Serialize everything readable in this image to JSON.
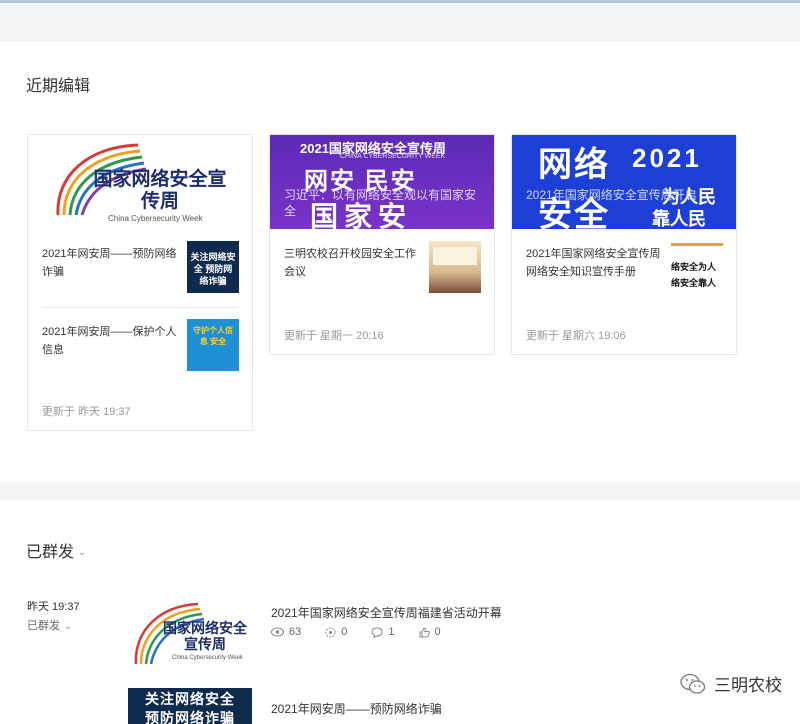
{
  "recent": {
    "title": "近期编辑",
    "cards": [
      {
        "cover_logo_cn": "国家网络安全宣传周",
        "cover_logo_en": "China Cybersecurity Week",
        "items": [
          {
            "title": "2021年网安周——预防网络诈骗",
            "thumb_text": "关注网络安全 预防网络诈骗"
          },
          {
            "title": "2021年网安周——保护个人信息",
            "thumb_text": "守护个人信息 安全"
          }
        ],
        "updated": "更新于 昨天 19:37"
      },
      {
        "cover_title": "习近平：以有网络安全观以有国家安全",
        "cover_banner": "2021国家网络安全宣传周",
        "cover_banner_en": "CHINA CYBERSECURITY WEEK",
        "cover_slogan_1": "网安 民安",
        "cover_slogan_2": "国家安",
        "items": [
          {
            "title": "三明农校召开校园安全工作会议"
          }
        ],
        "updated": "更新于 星期一 20:16"
      },
      {
        "cover_title": "2021年国家网络安全宣传周开启",
        "cover_big_1": "网络",
        "cover_big_2": "安全",
        "cover_year": "2021",
        "cover_slogan_1": "为人民",
        "cover_slogan_2": "靠人民",
        "items": [
          {
            "title": "2021年国家网络安全宣传周网络安全知识宣传手册",
            "thumb_line1": "络安全为人",
            "thumb_line2": "络安全靠人"
          }
        ],
        "updated": "更新于 星期六 19:06"
      }
    ]
  },
  "sent": {
    "title": "已群发",
    "rows": [
      {
        "time": "昨天 19:37",
        "status": "已群发",
        "title": "2021年国家网络安全宣传周福建省活动开幕",
        "thumb_cn": "国家网络安全宣传周",
        "thumb_en": "China Cybersecurity Week",
        "views": "63",
        "shares": "0",
        "comments": "1",
        "likes": "0"
      },
      {
        "title": "2021年网安周——预防网络诈骗",
        "thumb_line1": "关注网络安全",
        "thumb_line2": "预防网络诈骗"
      }
    ]
  },
  "watermark": "三明农校"
}
